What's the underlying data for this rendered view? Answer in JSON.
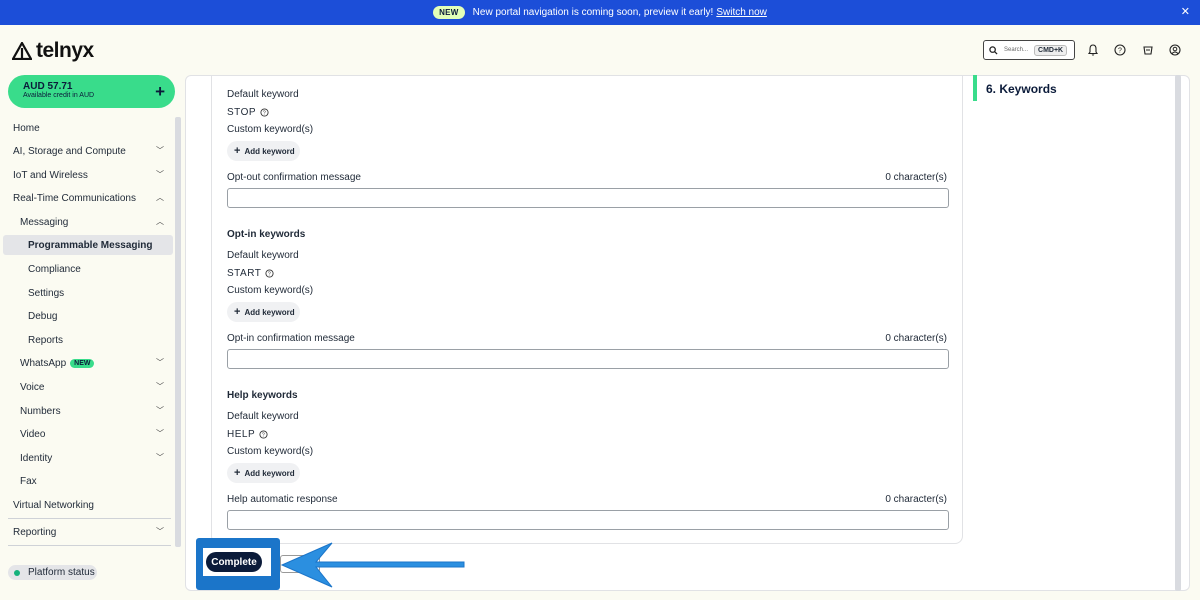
{
  "banner": {
    "badge": "NEW",
    "message": "New portal navigation is coming soon, preview it early!",
    "link": "Switch now",
    "close_icon": "close-icon"
  },
  "header": {
    "logo": "telnyx",
    "search_placeholder": "Search...",
    "search_shortcut": "CMD+K",
    "icons": [
      "search-icon",
      "bell-icon",
      "help-icon",
      "store-icon",
      "user-icon"
    ]
  },
  "sidebar": {
    "credit_amount": "AUD 57.71",
    "credit_sub": "Available credit in AUD",
    "items": [
      {
        "label": "Home"
      },
      {
        "label": "AI, Storage and Compute"
      },
      {
        "label": "IoT and Wireless"
      },
      {
        "label": "Real-Time Communications"
      },
      {
        "label": "Messaging"
      },
      {
        "label": "Programmable Messaging"
      },
      {
        "label": "Compliance"
      },
      {
        "label": "Settings"
      },
      {
        "label": "Debug"
      },
      {
        "label": "Reports"
      },
      {
        "label": "WhatsApp",
        "tag": "NEW"
      },
      {
        "label": "Voice"
      },
      {
        "label": "Numbers"
      },
      {
        "label": "Video"
      },
      {
        "label": "Identity"
      },
      {
        "label": "Fax"
      },
      {
        "label": "Virtual Networking"
      },
      {
        "label": "Reporting"
      }
    ],
    "platform_status": "Platform status"
  },
  "form": {
    "optout": {
      "default_label": "Default keyword",
      "keyword": "STOP",
      "custom_label": "Custom keyword(s)",
      "add_button": "Add keyword",
      "message_label": "Opt-out confirmation message",
      "char_count": "0 character(s)"
    },
    "optin": {
      "title": "Opt-in keywords",
      "default_label": "Default keyword",
      "keyword": "START",
      "custom_label": "Custom keyword(s)",
      "add_button": "Add keyword",
      "message_label": "Opt-in confirmation message",
      "char_count": "0 character(s)"
    },
    "help": {
      "title": "Help keywords",
      "default_label": "Default keyword",
      "keyword": "HELP",
      "custom_label": "Custom keyword(s)",
      "add_button": "Add keyword",
      "message_label": "Help automatic response",
      "char_count": "0 character(s)"
    },
    "complete_button": "Complete"
  },
  "toc": {
    "active_item": "6. Keywords"
  },
  "colors": {
    "banner": "#1c4ed8",
    "accent_green": "#39dc8b",
    "dark_navy": "#0b1b3a",
    "highlight_blue": "#1b75c9"
  }
}
